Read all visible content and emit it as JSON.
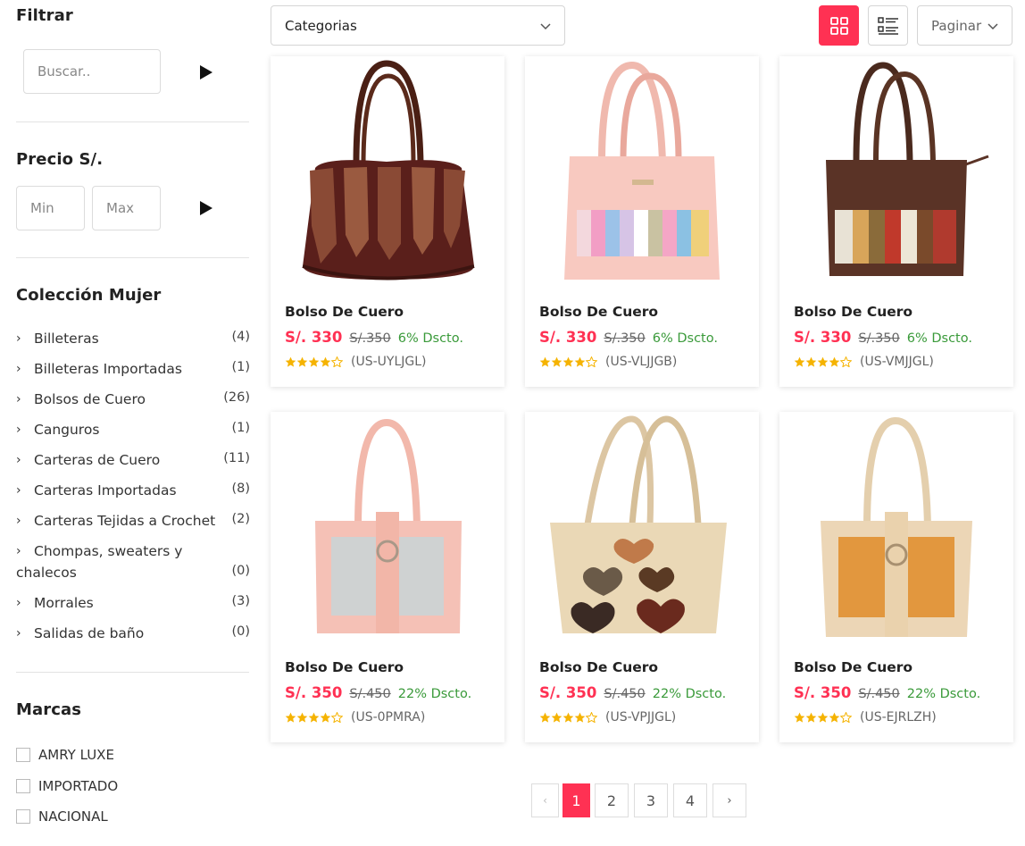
{
  "sidebar": {
    "filter_title": "Filtrar",
    "search_placeholder": "Buscar..",
    "price_title": "Precio S/.",
    "min_placeholder": "Min",
    "max_placeholder": "Max",
    "collection_title": "Colección Mujer",
    "categories": [
      {
        "label": "Billeteras",
        "count": "(4)"
      },
      {
        "label": "Billeteras Importadas",
        "count": "(1)"
      },
      {
        "label": "Bolsos de Cuero",
        "count": "(26)"
      },
      {
        "label": "Canguros",
        "count": "(1)"
      },
      {
        "label": "Carteras de Cuero",
        "count": "(11)"
      },
      {
        "label": "Carteras Importadas",
        "count": "(8)"
      },
      {
        "label": "Carteras Tejidas a Crochet",
        "count": "(2)"
      },
      {
        "label": "Chompas, sweaters y",
        "label_line2": "chalecos",
        "count": "(0)"
      },
      {
        "label": "Morrales",
        "count": "(3)"
      },
      {
        "label": "Salidas de baño",
        "count": "(0)"
      }
    ],
    "brands_title": "Marcas",
    "brands": [
      "AMRY LUXE",
      "IMPORTADO",
      "NACIONAL"
    ]
  },
  "toolbar": {
    "category_select": "Categorias",
    "paginate_select": "Paginar"
  },
  "products": [
    {
      "name": "Bolso De Cuero",
      "price": "S/. 330",
      "old_price": "S/.350",
      "discount": "6% Dscto.",
      "code": "(US-UYLJGL)",
      "rating": 4,
      "image": "brown-croc-bag"
    },
    {
      "name": "Bolso De Cuero",
      "price": "S/. 330",
      "old_price": "S/.350",
      "discount": "6% Dscto.",
      "code": "(US-VLJJGB)",
      "rating": 4,
      "image": "pink-patchwork-bag"
    },
    {
      "name": "Bolso De Cuero",
      "price": "S/. 330",
      "old_price": "S/.350",
      "discount": "6% Dscto.",
      "code": "(US-VMJJGL)",
      "rating": 4,
      "image": "brown-patchwork-bag"
    },
    {
      "name": "Bolso De Cuero",
      "price": "S/. 350",
      "old_price": "S/.450",
      "discount": "22% Dscto.",
      "code": "(US-0PMRA)",
      "rating": 4,
      "image": "pink-silver-buckle-bag"
    },
    {
      "name": "Bolso De Cuero",
      "price": "S/. 350",
      "old_price": "S/.450",
      "discount": "22% Dscto.",
      "code": "(US-VPJJGL)",
      "rating": 4,
      "image": "beige-hearts-bag"
    },
    {
      "name": "Bolso De Cuero",
      "price": "S/. 350",
      "old_price": "S/.450",
      "discount": "22% Dscto.",
      "code": "(US-EJRLZH)",
      "rating": 4,
      "image": "beige-orange-buckle-bag"
    }
  ],
  "pagination": {
    "prev": "‹",
    "pages": [
      "1",
      "2",
      "3",
      "4"
    ],
    "current": "1",
    "next": "›"
  },
  "colors": {
    "accent": "#ff3153",
    "discount": "#3a9a3a",
    "star": "#f5b301"
  }
}
